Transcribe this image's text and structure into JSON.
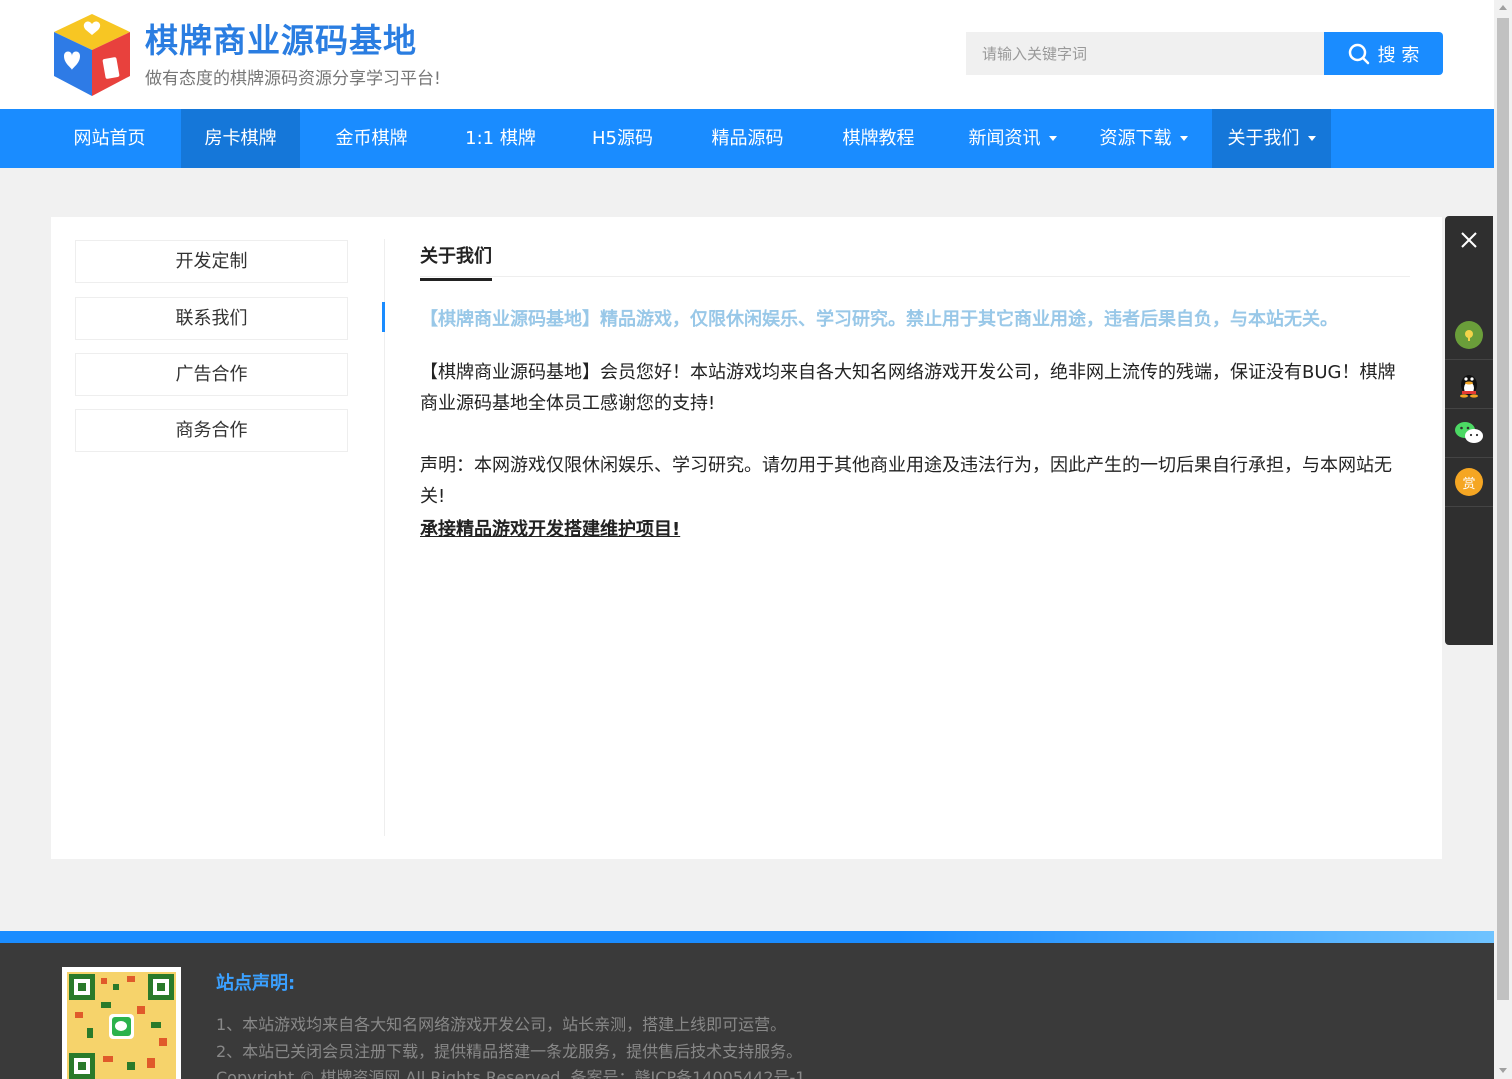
{
  "header": {
    "site_title": "棋牌商业源码基地",
    "slogan": "做有态度的棋牌源码资源分享学习平台!",
    "search_placeholder": "请输入关键字词",
    "search_label": "搜 索"
  },
  "nav": {
    "items": [
      {
        "label": "网站首页"
      },
      {
        "label": "房卡棋牌"
      },
      {
        "label": "金币棋牌"
      },
      {
        "label": "1:1 棋牌"
      },
      {
        "label": "H5源码"
      },
      {
        "label": "精品源码"
      },
      {
        "label": "棋牌教程"
      },
      {
        "label": "新闻资讯"
      },
      {
        "label": "资源下载"
      },
      {
        "label": "关于我们"
      }
    ]
  },
  "sidebar": {
    "items": [
      {
        "label": "开发定制"
      },
      {
        "label": "联系我们"
      },
      {
        "label": "广告合作"
      },
      {
        "label": "商务合作"
      }
    ]
  },
  "main": {
    "title": "关于我们",
    "notice": "【棋牌商业源码基地】精品游戏，仅限休闲娱乐、学习研究。禁止用于其它商业用途，违者后果自负，与本站无关。",
    "para1": "【棋牌商业源码基地】会员您好！本站游戏均来自各大知名网络游戏开发公司，绝非网上流传的残端，保证没有BUG！棋牌商业源码基地全体员工感谢您的支持!",
    "para2": "声明：本网游戏仅限休闲娱乐、学习研究。请勿用于其他商业用途及违法行为，因此产生的一切后果自行承担，与本网站无关!",
    "link": "承接精品游戏开发搭建维护项目!"
  },
  "float_panel": {
    "reward_label": "赏"
  },
  "footer": {
    "title": "站点声明:",
    "line1": "1、本站游戏均来自各大知名网络游戏开发公司，站长亲测，搭建上线即可运营。",
    "line2": "2、本站已关闭会员注册下载，提供精品搭建一条龙服务，提供售后技术支持服务。",
    "line3": "Copyright © 棋牌资源网 All Rights Reserved. 备案号：赣ICP备14005442号-1"
  },
  "colors": {
    "brand": "#1a8cff",
    "nav_active": "#1577d9",
    "notice": "#99c8e8",
    "footer_bg": "#3a3a3a"
  }
}
